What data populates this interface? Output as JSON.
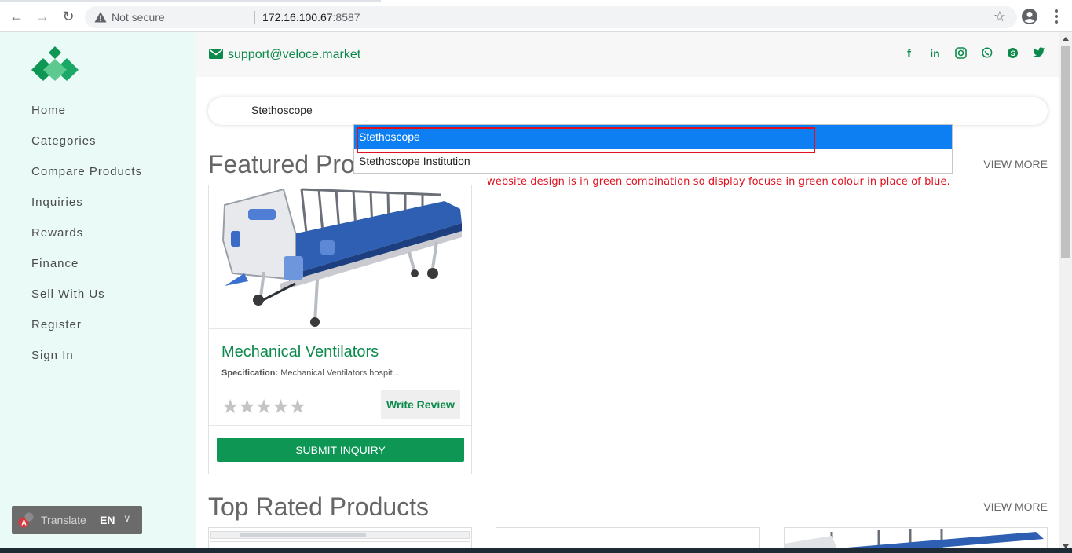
{
  "browser": {
    "security_label": "Not secure",
    "url_host": "172.16.100.67",
    "url_port": ":8587"
  },
  "topbar": {
    "support_email": "support@veloce.market",
    "social_icons": [
      "facebook-icon",
      "linkedin-icon",
      "instagram-icon",
      "whatsapp-icon",
      "skype-icon",
      "twitter-icon"
    ]
  },
  "sidebar": {
    "items": [
      {
        "label": "Home"
      },
      {
        "label": "Categories"
      },
      {
        "label": "Compare Products"
      },
      {
        "label": "Inquiries"
      },
      {
        "label": "Rewards"
      },
      {
        "label": "Finance"
      },
      {
        "label": "Sell With Us"
      },
      {
        "label": "Register"
      },
      {
        "label": "Sign In"
      }
    ],
    "translate": {
      "label": "Translate",
      "lang": "EN"
    }
  },
  "search": {
    "value": "Stethoscope",
    "suggestions": [
      "Stethoscope",
      "Stethoscope Institution"
    ]
  },
  "annotation": "website design is in green combination so display focuse in green colour in place of blue.",
  "featured": {
    "title": "Featured Products",
    "title_visible": "Featured Pro",
    "view_more": "VIEW MORE",
    "product": {
      "name": "Mechanical Ventilators",
      "spec_label": "Specification:",
      "spec_value": "Mechanical Ventilators hospit...",
      "rating": 0,
      "rating_max": 5,
      "review_label": "Write Review",
      "inquiry_label": "SUBMIT INQUIRY"
    }
  },
  "top_rated": {
    "title": "Top Rated Products",
    "view_more": "VIEW MORE"
  },
  "colors": {
    "brand_green": "#0b8a4b",
    "button_green": "#0e9655",
    "highlight_blue": "#0d7ff2",
    "annotation_red": "#e0101e",
    "sidebar_bg": "#eafaf6"
  }
}
